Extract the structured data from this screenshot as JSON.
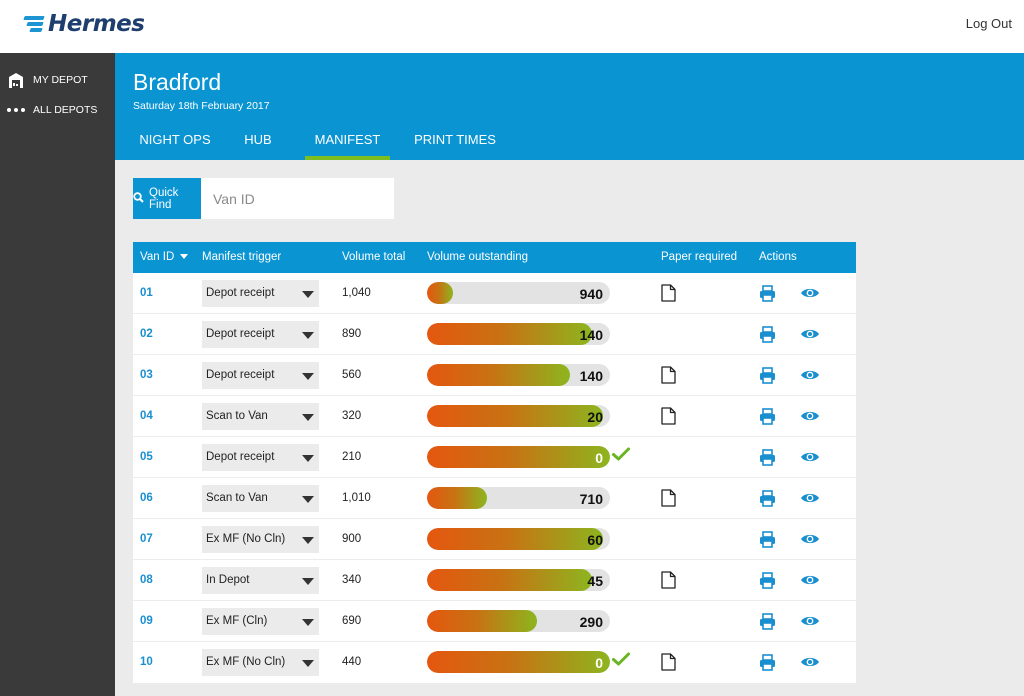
{
  "brand": {
    "name": "Hermes",
    "color": "#1d3e6e",
    "accent": "#1e95d3"
  },
  "topbar": {
    "logout_label": "Log Out"
  },
  "sidebar": {
    "items": [
      {
        "label": "MY DEPOT",
        "icon": "depot-icon"
      },
      {
        "label": "ALL DEPOTS",
        "icon": "dots-icon"
      }
    ]
  },
  "header": {
    "title": "Bradford",
    "date": "Saturday 18th February 2017",
    "tabs": [
      {
        "label": "NIGHT OPS",
        "active": false
      },
      {
        "label": "HUB",
        "active": false
      },
      {
        "label": "MANIFEST",
        "active": true
      },
      {
        "label": "PRINT TIMES",
        "active": false
      }
    ]
  },
  "quickfind": {
    "button_label": "Quick Find",
    "placeholder": "Van ID",
    "value": ""
  },
  "table": {
    "headers": {
      "van_id": "Van ID",
      "trigger": "Manifest trigger",
      "total": "Volume total",
      "outstanding": "Volume outstanding",
      "paper": "Paper required",
      "actions": "Actions"
    },
    "sort_column": "van_id",
    "rows": [
      {
        "van_id": "01",
        "trigger": "Depot receipt",
        "total": "1,040",
        "outstanding": "940",
        "progress": 0.14,
        "paper": true,
        "done": false
      },
      {
        "van_id": "02",
        "trigger": "Depot receipt",
        "total": "890",
        "outstanding": "140",
        "progress": 0.9,
        "paper": false,
        "done": false
      },
      {
        "van_id": "03",
        "trigger": "Depot receipt",
        "total": "560",
        "outstanding": "140",
        "progress": 0.78,
        "paper": true,
        "done": false
      },
      {
        "van_id": "04",
        "trigger": "Scan to Van",
        "total": "320",
        "outstanding": "20",
        "progress": 0.96,
        "paper": true,
        "done": false
      },
      {
        "van_id": "05",
        "trigger": "Depot receipt",
        "total": "210",
        "outstanding": "0",
        "progress": 1.0,
        "paper": false,
        "done": true
      },
      {
        "van_id": "06",
        "trigger": "Scan to Van",
        "total": "1,010",
        "outstanding": "710",
        "progress": 0.33,
        "paper": true,
        "done": false
      },
      {
        "van_id": "07",
        "trigger": "Ex MF (No Cln)",
        "total": "900",
        "outstanding": "60",
        "progress": 0.96,
        "paper": false,
        "done": false
      },
      {
        "van_id": "08",
        "trigger": "In Depot",
        "total": "340",
        "outstanding": "45",
        "progress": 0.9,
        "paper": true,
        "done": false
      },
      {
        "van_id": "09",
        "trigger": "Ex MF (Cln)",
        "total": "690",
        "outstanding": "290",
        "progress": 0.6,
        "paper": false,
        "done": false
      },
      {
        "van_id": "10",
        "trigger": "Ex MF (No Cln)",
        "total": "440",
        "outstanding": "0",
        "progress": 1.0,
        "paper": true,
        "done": true
      }
    ]
  },
  "colors": {
    "primary_blue": "#0a94d2",
    "active_tab_underline": "#7cbd1f",
    "progress_start": "#e4570f",
    "progress_end": "#8db51f",
    "check_green": "#6ab523",
    "sidebar_bg": "#3a3a3a"
  }
}
